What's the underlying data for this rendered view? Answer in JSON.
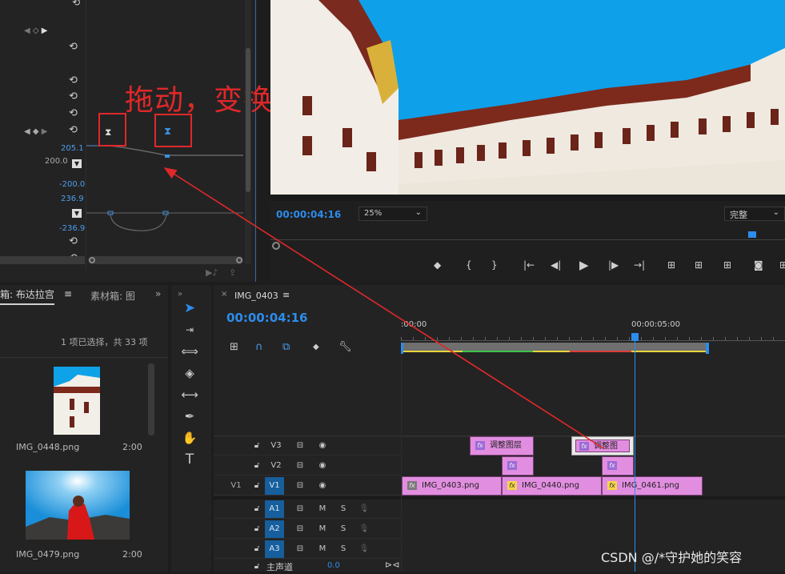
{
  "effect_controls": {
    "values": {
      "v1": "205.1",
      "v2": "200.0",
      "v3": "-200.0",
      "v4": "236.9",
      "v5": "-236.9"
    },
    "annotation_text": "拖动，变换位置"
  },
  "program_monitor": {
    "timecode": "00:00:04:16",
    "zoom": "25%",
    "quality": "完整"
  },
  "project_panel": {
    "tab1": "箱: 布达拉宫",
    "tab2": "素材箱: 图",
    "selection_info": "1 项已选择，共 33 项",
    "items": [
      {
        "name": "IMG_0448.png",
        "duration": "2:00"
      },
      {
        "name": "IMG_0479.png",
        "duration": "2:00"
      }
    ]
  },
  "timeline": {
    "sequence_name": "IMG_0403",
    "timecode": "00:00:04:16",
    "ruler": {
      "start": ":00:00",
      "mark": "00:00:05:00"
    },
    "tracks": {
      "v3": "V3",
      "v2": "V2",
      "v1": "V1",
      "v1_source": "V1",
      "a1": "A1",
      "a2": "A2",
      "a3": "A3",
      "master": "主声道",
      "master_value": "0.0"
    },
    "mute": "M",
    "solo": "S",
    "clips": {
      "v3_a": "调整图层",
      "v3_b": "调整图",
      "v1_a": "IMG_0403.png",
      "v1_b": "IMG_0440.png",
      "v1_c": "IMG_0461.png",
      "fx": "fx"
    }
  },
  "watermark": "CSDN @/*守护她的笑容",
  "colors": {
    "accent_blue": "#2d8ceb",
    "clip_pink": "#e28ee0",
    "annotation_red": "#e0282a",
    "sky_blue": "#0fa0ea"
  }
}
